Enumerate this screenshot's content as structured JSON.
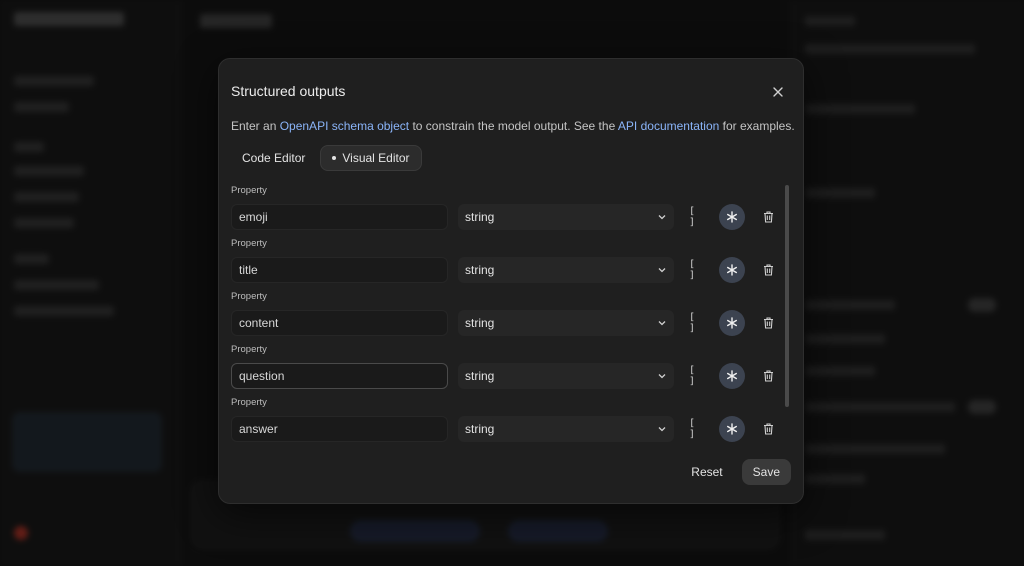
{
  "dialog": {
    "title": "Structured outputs",
    "description_prefix": "Enter an ",
    "description_link1": "OpenAPI schema object",
    "description_middle": " to constrain the model output. See the ",
    "description_link2": "API documentation",
    "description_suffix": " for examples."
  },
  "tabs": [
    {
      "label": "Code Editor",
      "active": false
    },
    {
      "label": "Visual Editor",
      "active": true
    }
  ],
  "properties": [
    {
      "label": "Property",
      "name": "emoji",
      "type": "string",
      "array_icon": "[ ]"
    },
    {
      "label": "Property",
      "name": "title",
      "type": "string",
      "array_icon": "[ ]"
    },
    {
      "label": "Property",
      "name": "content",
      "type": "string",
      "array_icon": "[ ]"
    },
    {
      "label": "Property",
      "name": "question",
      "type": "string",
      "array_icon": "[ ]"
    },
    {
      "label": "Property",
      "name": "answer",
      "type": "string",
      "array_icon": "[ ]"
    }
  ],
  "footer": {
    "reset_label": "Reset",
    "save_label": "Save"
  },
  "icons": {
    "close": "close-icon",
    "chevron": "chevron-down-icon",
    "required": "asterisk-icon",
    "delete": "trash-icon"
  },
  "colors": {
    "link": "#8ab4f8",
    "modal_bg": "#1f1f1f",
    "required_btn": "#3c4350"
  }
}
